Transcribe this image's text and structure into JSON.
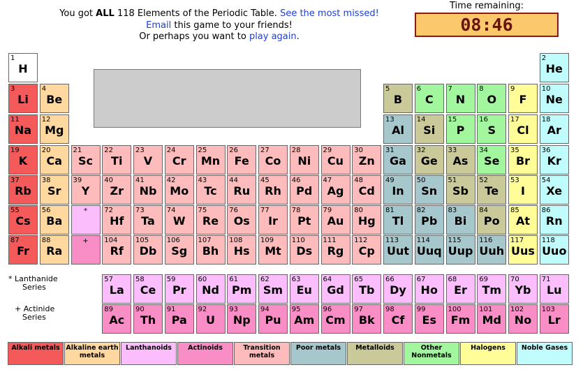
{
  "message": {
    "line1_pre": "You got ",
    "line1_bold": "ALL",
    "line1_mid": " 118 Elements of the Periodic Table. ",
    "line1_link": "See the most missed!",
    "line2_link": "Email",
    "line2_rest": " this game to your friends!",
    "line3_pre": "Or perhaps you want to ",
    "line3_link": "play again",
    "line3_post": "."
  },
  "timer": {
    "label": "Time remaining:",
    "value": "08:46"
  },
  "colors": {
    "alkali": "#f45a5a",
    "alkaline": "#fed89f",
    "lanthanoid": "#fcbdfc",
    "actinoid": "#f98ec7",
    "transition": "#fdbcbb",
    "poor": "#a6c7cb",
    "metalloid": "#c9c99a",
    "nonmetal": "#a2f79e",
    "halogen": "#fffd97",
    "noble": "#c0fcfc",
    "hydrogen": "#ffffff",
    "empty_board": "#cccccc"
  },
  "elements": [
    {
      "n": "1",
      "s": "H",
      "c": "hydrogen",
      "col": 1,
      "row": 1
    },
    {
      "n": "2",
      "s": "He",
      "c": "noble",
      "col": 18,
      "row": 1
    },
    {
      "n": "3",
      "s": "Li",
      "c": "alkali",
      "col": 1,
      "row": 2
    },
    {
      "n": "4",
      "s": "Be",
      "c": "alkaline",
      "col": 2,
      "row": 2
    },
    {
      "n": "5",
      "s": "B",
      "c": "metalloid",
      "col": 13,
      "row": 2
    },
    {
      "n": "6",
      "s": "C",
      "c": "nonmetal",
      "col": 14,
      "row": 2
    },
    {
      "n": "7",
      "s": "N",
      "c": "nonmetal",
      "col": 15,
      "row": 2
    },
    {
      "n": "8",
      "s": "O",
      "c": "nonmetal",
      "col": 16,
      "row": 2
    },
    {
      "n": "9",
      "s": "F",
      "c": "halogen",
      "col": 17,
      "row": 2
    },
    {
      "n": "10",
      "s": "Ne",
      "c": "noble",
      "col": 18,
      "row": 2
    },
    {
      "n": "11",
      "s": "Na",
      "c": "alkali",
      "col": 1,
      "row": 3
    },
    {
      "n": "12",
      "s": "Mg",
      "c": "alkaline",
      "col": 2,
      "row": 3
    },
    {
      "n": "13",
      "s": "Al",
      "c": "poor",
      "col": 13,
      "row": 3
    },
    {
      "n": "14",
      "s": "Si",
      "c": "metalloid",
      "col": 14,
      "row": 3
    },
    {
      "n": "15",
      "s": "P",
      "c": "nonmetal",
      "col": 15,
      "row": 3
    },
    {
      "n": "16",
      "s": "S",
      "c": "nonmetal",
      "col": 16,
      "row": 3
    },
    {
      "n": "17",
      "s": "Cl",
      "c": "halogen",
      "col": 17,
      "row": 3
    },
    {
      "n": "18",
      "s": "Ar",
      "c": "noble",
      "col": 18,
      "row": 3
    },
    {
      "n": "19",
      "s": "K",
      "c": "alkali",
      "col": 1,
      "row": 4
    },
    {
      "n": "20",
      "s": "Ca",
      "c": "alkaline",
      "col": 2,
      "row": 4
    },
    {
      "n": "21",
      "s": "Sc",
      "c": "transition",
      "col": 3,
      "row": 4
    },
    {
      "n": "22",
      "s": "Ti",
      "c": "transition",
      "col": 4,
      "row": 4
    },
    {
      "n": "23",
      "s": "V",
      "c": "transition",
      "col": 5,
      "row": 4
    },
    {
      "n": "24",
      "s": "Cr",
      "c": "transition",
      "col": 6,
      "row": 4
    },
    {
      "n": "25",
      "s": "Mn",
      "c": "transition",
      "col": 7,
      "row": 4
    },
    {
      "n": "26",
      "s": "Fe",
      "c": "transition",
      "col": 8,
      "row": 4
    },
    {
      "n": "27",
      "s": "Co",
      "c": "transition",
      "col": 9,
      "row": 4
    },
    {
      "n": "28",
      "s": "Ni",
      "c": "transition",
      "col": 10,
      "row": 4
    },
    {
      "n": "29",
      "s": "Cu",
      "c": "transition",
      "col": 11,
      "row": 4
    },
    {
      "n": "30",
      "s": "Zn",
      "c": "transition",
      "col": 12,
      "row": 4
    },
    {
      "n": "31",
      "s": "Ga",
      "c": "poor",
      "col": 13,
      "row": 4
    },
    {
      "n": "32",
      "s": "Ge",
      "c": "metalloid",
      "col": 14,
      "row": 4
    },
    {
      "n": "33",
      "s": "As",
      "c": "metalloid",
      "col": 15,
      "row": 4
    },
    {
      "n": "34",
      "s": "Se",
      "c": "nonmetal",
      "col": 16,
      "row": 4
    },
    {
      "n": "35",
      "s": "Br",
      "c": "halogen",
      "col": 17,
      "row": 4
    },
    {
      "n": "36",
      "s": "Kr",
      "c": "noble",
      "col": 18,
      "row": 4
    },
    {
      "n": "37",
      "s": "Rb",
      "c": "alkali",
      "col": 1,
      "row": 5
    },
    {
      "n": "38",
      "s": "Sr",
      "c": "alkaline",
      "col": 2,
      "row": 5
    },
    {
      "n": "39",
      "s": "Y",
      "c": "transition",
      "col": 3,
      "row": 5
    },
    {
      "n": "40",
      "s": "Zr",
      "c": "transition",
      "col": 4,
      "row": 5
    },
    {
      "n": "41",
      "s": "Nb",
      "c": "transition",
      "col": 5,
      "row": 5
    },
    {
      "n": "42",
      "s": "Mo",
      "c": "transition",
      "col": 6,
      "row": 5
    },
    {
      "n": "43",
      "s": "Tc",
      "c": "transition",
      "col": 7,
      "row": 5
    },
    {
      "n": "44",
      "s": "Ru",
      "c": "transition",
      "col": 8,
      "row": 5
    },
    {
      "n": "45",
      "s": "Rh",
      "c": "transition",
      "col": 9,
      "row": 5
    },
    {
      "n": "46",
      "s": "Pd",
      "c": "transition",
      "col": 10,
      "row": 5
    },
    {
      "n": "47",
      "s": "Ag",
      "c": "transition",
      "col": 11,
      "row": 5
    },
    {
      "n": "48",
      "s": "Cd",
      "c": "transition",
      "col": 12,
      "row": 5
    },
    {
      "n": "49",
      "s": "In",
      "c": "poor",
      "col": 13,
      "row": 5
    },
    {
      "n": "50",
      "s": "Sn",
      "c": "poor",
      "col": 14,
      "row": 5
    },
    {
      "n": "51",
      "s": "Sb",
      "c": "metalloid",
      "col": 15,
      "row": 5
    },
    {
      "n": "52",
      "s": "Te",
      "c": "metalloid",
      "col": 16,
      "row": 5
    },
    {
      "n": "53",
      "s": "I",
      "c": "halogen",
      "col": 17,
      "row": 5
    },
    {
      "n": "54",
      "s": "Xe",
      "c": "noble",
      "col": 18,
      "row": 5
    },
    {
      "n": "55",
      "s": "Cs",
      "c": "alkali",
      "col": 1,
      "row": 6
    },
    {
      "n": "56",
      "s": "Ba",
      "c": "alkaline",
      "col": 2,
      "row": 6
    },
    {
      "n": "*",
      "s": "",
      "c": "lanthanoid",
      "col": 3,
      "row": 6
    },
    {
      "n": "72",
      "s": "Hf",
      "c": "transition",
      "col": 4,
      "row": 6
    },
    {
      "n": "73",
      "s": "Ta",
      "c": "transition",
      "col": 5,
      "row": 6
    },
    {
      "n": "74",
      "s": "W",
      "c": "transition",
      "col": 6,
      "row": 6
    },
    {
      "n": "75",
      "s": "Re",
      "c": "transition",
      "col": 7,
      "row": 6
    },
    {
      "n": "76",
      "s": "Os",
      "c": "transition",
      "col": 8,
      "row": 6
    },
    {
      "n": "77",
      "s": "Ir",
      "c": "transition",
      "col": 9,
      "row": 6
    },
    {
      "n": "78",
      "s": "Pt",
      "c": "transition",
      "col": 10,
      "row": 6
    },
    {
      "n": "79",
      "s": "Au",
      "c": "transition",
      "col": 11,
      "row": 6
    },
    {
      "n": "80",
      "s": "Hg",
      "c": "transition",
      "col": 12,
      "row": 6
    },
    {
      "n": "81",
      "s": "Tl",
      "c": "poor",
      "col": 13,
      "row": 6
    },
    {
      "n": "82",
      "s": "Pb",
      "c": "poor",
      "col": 14,
      "row": 6
    },
    {
      "n": "83",
      "s": "Bi",
      "c": "poor",
      "col": 15,
      "row": 6
    },
    {
      "n": "84",
      "s": "Po",
      "c": "metalloid",
      "col": 16,
      "row": 6
    },
    {
      "n": "85",
      "s": "At",
      "c": "halogen",
      "col": 17,
      "row": 6
    },
    {
      "n": "86",
      "s": "Rn",
      "c": "noble",
      "col": 18,
      "row": 6
    },
    {
      "n": "87",
      "s": "Fr",
      "c": "alkali",
      "col": 1,
      "row": 7
    },
    {
      "n": "88",
      "s": "Ra",
      "c": "alkaline",
      "col": 2,
      "row": 7
    },
    {
      "n": "+",
      "s": "",
      "c": "actinoid",
      "col": 3,
      "row": 7
    },
    {
      "n": "104",
      "s": "Rf",
      "c": "transition",
      "col": 4,
      "row": 7
    },
    {
      "n": "105",
      "s": "Db",
      "c": "transition",
      "col": 5,
      "row": 7
    },
    {
      "n": "106",
      "s": "Sg",
      "c": "transition",
      "col": 6,
      "row": 7
    },
    {
      "n": "107",
      "s": "Bh",
      "c": "transition",
      "col": 7,
      "row": 7
    },
    {
      "n": "108",
      "s": "Hs",
      "c": "transition",
      "col": 8,
      "row": 7
    },
    {
      "n": "109",
      "s": "Mt",
      "c": "transition",
      "col": 9,
      "row": 7
    },
    {
      "n": "110",
      "s": "Ds",
      "c": "transition",
      "col": 10,
      "row": 7
    },
    {
      "n": "111",
      "s": "Rg",
      "c": "transition",
      "col": 11,
      "row": 7
    },
    {
      "n": "112",
      "s": "Cp",
      "c": "transition",
      "col": 12,
      "row": 7
    },
    {
      "n": "113",
      "s": "Uut",
      "c": "poor",
      "col": 13,
      "row": 7
    },
    {
      "n": "114",
      "s": "Uuq",
      "c": "poor",
      "col": 14,
      "row": 7
    },
    {
      "n": "115",
      "s": "Uup",
      "c": "poor",
      "col": 15,
      "row": 7
    },
    {
      "n": "116",
      "s": "Uuh",
      "c": "poor",
      "col": 16,
      "row": 7
    },
    {
      "n": "117",
      "s": "Uus",
      "c": "halogen",
      "col": 17,
      "row": 7
    },
    {
      "n": "118",
      "s": "Uuo",
      "c": "noble",
      "col": 18,
      "row": 7
    },
    {
      "n": "57",
      "s": "La",
      "c": "lanthanoid",
      "col": 4,
      "row": 9
    },
    {
      "n": "58",
      "s": "Ce",
      "c": "lanthanoid",
      "col": 5,
      "row": 9
    },
    {
      "n": "59",
      "s": "Pr",
      "c": "lanthanoid",
      "col": 6,
      "row": 9
    },
    {
      "n": "60",
      "s": "Nd",
      "c": "lanthanoid",
      "col": 7,
      "row": 9
    },
    {
      "n": "61",
      "s": "Pm",
      "c": "lanthanoid",
      "col": 8,
      "row": 9
    },
    {
      "n": "62",
      "s": "Sm",
      "c": "lanthanoid",
      "col": 9,
      "row": 9
    },
    {
      "n": "63",
      "s": "Eu",
      "c": "lanthanoid",
      "col": 10,
      "row": 9
    },
    {
      "n": "64",
      "s": "Gd",
      "c": "lanthanoid",
      "col": 11,
      "row": 9
    },
    {
      "n": "65",
      "s": "Tb",
      "c": "lanthanoid",
      "col": 12,
      "row": 9
    },
    {
      "n": "66",
      "s": "Dy",
      "c": "lanthanoid",
      "col": 13,
      "row": 9
    },
    {
      "n": "67",
      "s": "Ho",
      "c": "lanthanoid",
      "col": 14,
      "row": 9
    },
    {
      "n": "68",
      "s": "Er",
      "c": "lanthanoid",
      "col": 15,
      "row": 9
    },
    {
      "n": "69",
      "s": "Tm",
      "c": "lanthanoid",
      "col": 16,
      "row": 9
    },
    {
      "n": "70",
      "s": "Yb",
      "c": "lanthanoid",
      "col": 17,
      "row": 9
    },
    {
      "n": "71",
      "s": "Lu",
      "c": "lanthanoid",
      "col": 18,
      "row": 9
    },
    {
      "n": "89",
      "s": "Ac",
      "c": "actinoid",
      "col": 4,
      "row": 10
    },
    {
      "n": "90",
      "s": "Th",
      "c": "actinoid",
      "col": 5,
      "row": 10
    },
    {
      "n": "91",
      "s": "Pa",
      "c": "actinoid",
      "col": 6,
      "row": 10
    },
    {
      "n": "92",
      "s": "U",
      "c": "actinoid",
      "col": 7,
      "row": 10
    },
    {
      "n": "93",
      "s": "Np",
      "c": "actinoid",
      "col": 8,
      "row": 10
    },
    {
      "n": "94",
      "s": "Pu",
      "c": "actinoid",
      "col": 9,
      "row": 10
    },
    {
      "n": "95",
      "s": "Am",
      "c": "actinoid",
      "col": 10,
      "row": 10
    },
    {
      "n": "96",
      "s": "Cm",
      "c": "actinoid",
      "col": 11,
      "row": 10
    },
    {
      "n": "97",
      "s": "Bk",
      "c": "actinoid",
      "col": 12,
      "row": 10
    },
    {
      "n": "98",
      "s": "Cf",
      "c": "actinoid",
      "col": 13,
      "row": 10
    },
    {
      "n": "99",
      "s": "Es",
      "c": "actinoid",
      "col": 14,
      "row": 10
    },
    {
      "n": "100",
      "s": "Fm",
      "c": "actinoid",
      "col": 15,
      "row": 10
    },
    {
      "n": "101",
      "s": "Md",
      "c": "actinoid",
      "col": 16,
      "row": 10
    },
    {
      "n": "102",
      "s": "No",
      "c": "actinoid",
      "col": 17,
      "row": 10
    },
    {
      "n": "103",
      "s": "Lr",
      "c": "actinoid",
      "col": 18,
      "row": 10
    }
  ],
  "series": {
    "lanthanide": {
      "star": "* Lanthanide",
      "word": "Series"
    },
    "actinide": {
      "star": "+ Actinide",
      "word": "Series"
    }
  },
  "legend": [
    {
      "label": "Alkali metals",
      "c": "alkali"
    },
    {
      "label": "Alkaline earth metals",
      "c": "alkaline"
    },
    {
      "label": "Lanthanoids",
      "c": "lanthanoid"
    },
    {
      "label": "Actinoids",
      "c": "actinoid"
    },
    {
      "label": "Transition metals",
      "c": "transition"
    },
    {
      "label": "Poor metals",
      "c": "poor"
    },
    {
      "label": "Metalloids",
      "c": "metalloid"
    },
    {
      "label": "Other Nonmetals",
      "c": "nonmetal"
    },
    {
      "label": "Halogens",
      "c": "halogen"
    },
    {
      "label": "Noble Gases",
      "c": "noble"
    }
  ]
}
